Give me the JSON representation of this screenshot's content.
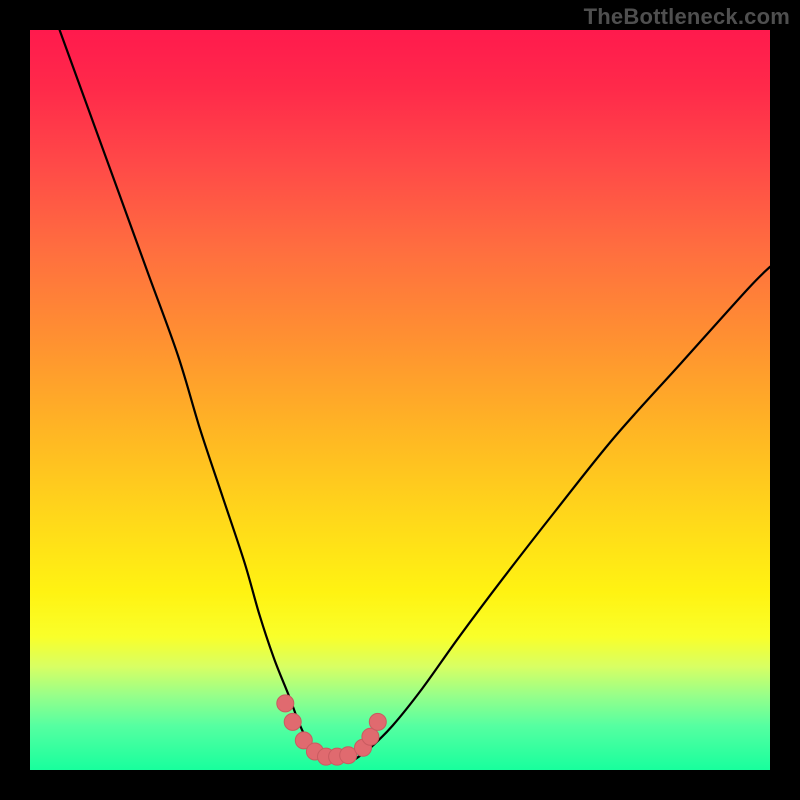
{
  "watermark": {
    "text": "TheBottleneck.com"
  },
  "colors": {
    "frame": "#000000",
    "curve_stroke": "#000000",
    "marker_fill": "#e06a6f",
    "marker_stroke": "#c95b60"
  },
  "chart_data": {
    "type": "line",
    "title": "",
    "xlabel": "",
    "ylabel": "",
    "xlim": [
      0,
      100
    ],
    "ylim": [
      0,
      100
    ],
    "grid": false,
    "legend": false,
    "notes": "Values estimated from pixel positions. y increases upward (0 = bottom/green, 100 = top/red). Two curve branches (left/right arms of a V) plus a small cluster of highlighted markers near the trough.",
    "series": [
      {
        "name": "left-branch",
        "x": [
          4,
          8,
          12,
          16,
          20,
          23,
          26,
          29,
          31,
          33,
          35,
          36.5,
          38,
          39
        ],
        "y": [
          100,
          89,
          78,
          67,
          56,
          46,
          37,
          28,
          21,
          15,
          10,
          6,
          3,
          1.5
        ]
      },
      {
        "name": "right-branch",
        "x": [
          44,
          46,
          49,
          53,
          58,
          64,
          71,
          79,
          88,
          97,
          100
        ],
        "y": [
          1.5,
          3,
          6,
          11,
          18,
          26,
          35,
          45,
          55,
          65,
          68
        ]
      },
      {
        "name": "trough-markers",
        "type": "scatter",
        "x": [
          34.5,
          35.5,
          37,
          38.5,
          40,
          41.5,
          43,
          45,
          46,
          47
        ],
        "y": [
          9,
          6.5,
          4,
          2.5,
          1.8,
          1.8,
          2,
          3,
          4.5,
          6.5
        ]
      }
    ]
  }
}
